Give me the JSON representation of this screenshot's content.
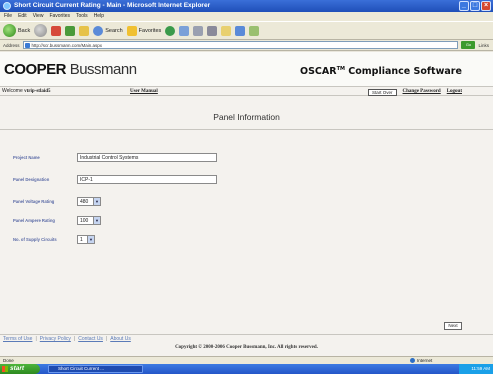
{
  "window": {
    "title": "Short Circuit Current Rating - Main - Microsoft Internet Explorer"
  },
  "menu": [
    "File",
    "Edit",
    "View",
    "Favorites",
    "Tools",
    "Help"
  ],
  "toolbar": {
    "back": "Back",
    "search": "Search",
    "favorites": "Favorites"
  },
  "address": {
    "label": "Address",
    "url": "http://scr.bussmann.com/Main.aspx",
    "go": "Go",
    "links": "Links"
  },
  "header": {
    "logo_bold": "COOPER",
    "logo_light": "Bussmann",
    "product": "OSCAR",
    "product_tm": "TM",
    "product_rest": "Compliance Software"
  },
  "nav": {
    "welcome_prefix": "Welcome ",
    "username": "vtrip-stlaid5",
    "user_manual": "User Manual",
    "start_over": "Start Over",
    "change_password": "Change Password",
    "logout": "Logout"
  },
  "panel": {
    "title": "Panel Information",
    "fields": [
      {
        "label": "Project Name",
        "value": "Industrial Control Systems"
      },
      {
        "label": "Panel Designation",
        "value": "ICP-1"
      },
      {
        "label": "Panel Voltage Rating",
        "value": "480"
      },
      {
        "label": "Panel Ampere Rating",
        "value": "100"
      },
      {
        "label": "No. of Supply Circuits",
        "value": "1"
      }
    ],
    "next": "Next"
  },
  "footer": {
    "links": [
      "Terms of Use",
      "Privacy Policy",
      "Contact Us",
      "About Us"
    ],
    "copyright": "Copyright © 2000-2006 Cooper Bussmann, Inc. All rights reserved."
  },
  "status": {
    "left": "Done",
    "zone": "Internet"
  },
  "taskbar": {
    "start": "start",
    "task": "Short Circuit Current ...",
    "clock": "11:59 AM"
  }
}
